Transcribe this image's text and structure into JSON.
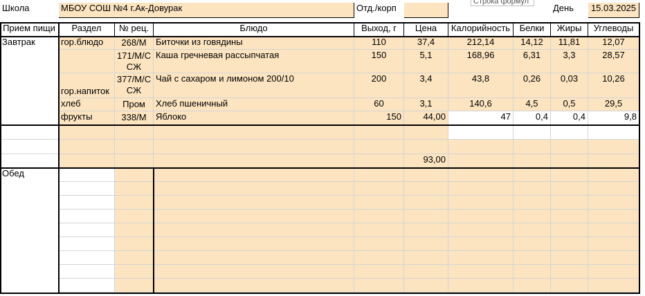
{
  "header": {
    "school_label": "Школа",
    "school_value": "МБОУ СОШ №4 г.Ак-Довурак",
    "dept_label": "Отд./корп",
    "dept_value": "",
    "formula_tooltip": "Строка формул",
    "day_label": "День",
    "day_value": "15.03.2025"
  },
  "columns": [
    "Прием пищи",
    "Раздел",
    "№ рец.",
    "Блюдо",
    "Выход, г",
    "Цена",
    "Калорийность",
    "Белки",
    "Жиры",
    "Углеводы"
  ],
  "breakfast": {
    "meal": "Завтрак",
    "rows": [
      {
        "section": "гор.блюдо",
        "recipe": "268/М",
        "dish": "Биточки из говядины",
        "yield": "110",
        "price": "37,4",
        "kcal": "212,14",
        "protein": "14,12",
        "fat": "11,81",
        "carbs": "12,07"
      },
      {
        "section": "",
        "recipe": "171/М/С\nСЖ",
        "dish": "Каша гречневая рассыпчатая",
        "yield": "150",
        "price": "5,1",
        "kcal": "168,96",
        "protein": "6,31",
        "fat": "3,3",
        "carbs": "28,57"
      },
      {
        "section": "гор.напиток",
        "recipe": "377/М/С\nСЖ",
        "dish": "Чай с сахаром и лимоном 200/10",
        "yield": "200",
        "price": "3,4",
        "kcal": "43,8",
        "protein": "0,26",
        "fat": "0,03",
        "carbs": "10,26"
      },
      {
        "section": "хлеб",
        "recipe": "Пром",
        "dish": "Хлеб пшеничный",
        "yield": "60",
        "price": "3,1",
        "kcal": "140,6",
        "protein": "4,5",
        "fat": "0,5",
        "carbs": "29,5"
      },
      {
        "section": "фрукты",
        "recipe": "338/М",
        "dish": "Яблоко",
        "yield": "150",
        "price": "44,00",
        "kcal": "47",
        "protein": "0,4",
        "fat": "0,4",
        "carbs": "9,8"
      }
    ],
    "total_price": "93,00"
  },
  "lunch": {
    "meal": "Обед"
  },
  "colors": {
    "cell_fill": "#FCE4C0",
    "grid_line": "#d4d4d4",
    "comment_marker": "#1a7f1a"
  }
}
